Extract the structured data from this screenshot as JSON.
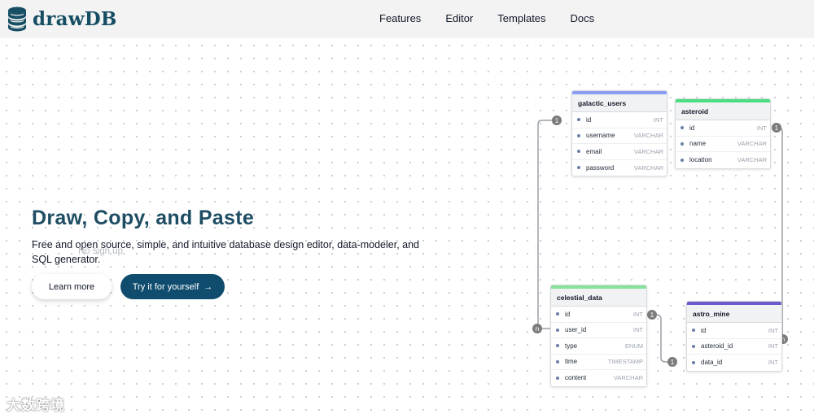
{
  "app": {
    "name": "drawDB"
  },
  "nav": [
    {
      "label": "Features"
    },
    {
      "label": "Editor"
    },
    {
      "label": "Templates"
    },
    {
      "label": "Docs"
    }
  ],
  "hero": {
    "title": "Draw, Copy, and Paste",
    "description": "Free and open source, simple, and intuitive database design editor, data-modeler, and SQL generator.",
    "no_signup": "No sign up",
    "learn_more": "Learn more",
    "try_it": "Try it for yourself",
    "try_arrow": "→"
  },
  "colors": {
    "brand": "#164e63",
    "primary_button": "#0f4c6e",
    "galactic_users_bar": "#8a9ef1",
    "asteroid_bar": "#4ade80",
    "celestial_data_bar": "#86e39a",
    "astro_mine_bar": "#6a5acd"
  },
  "tables": [
    {
      "name": "galactic_users",
      "rows": [
        {
          "field": "id",
          "type": "INT"
        },
        {
          "field": "username",
          "type": "VARCHAR"
        },
        {
          "field": "email",
          "type": "VARCHAR"
        },
        {
          "field": "password",
          "type": "VARCHAR"
        }
      ]
    },
    {
      "name": "asteroid",
      "rows": [
        {
          "field": "id",
          "type": "INT"
        },
        {
          "field": "name",
          "type": "VARCHAR"
        },
        {
          "field": "location",
          "type": "VARCHAR"
        }
      ]
    },
    {
      "name": "celestial_data",
      "rows": [
        {
          "field": "id",
          "type": "INT"
        },
        {
          "field": "user_id",
          "type": "INT"
        },
        {
          "field": "type",
          "type": "ENUM"
        },
        {
          "field": "time",
          "type": "TIMESTAMP"
        },
        {
          "field": "content",
          "type": "VARCHAR"
        }
      ]
    },
    {
      "name": "astro_mine",
      "rows": [
        {
          "field": "id",
          "type": "INT"
        },
        {
          "field": "asteroid_id",
          "type": "INT"
        },
        {
          "field": "data_id",
          "type": "INT"
        }
      ]
    }
  ],
  "relations": {
    "users_one": "1",
    "celestial_many": "n",
    "asteroid_one": "1",
    "astro_many": "n",
    "celestial_one": "1",
    "data_one": "1"
  },
  "watermark": "大数跨境"
}
